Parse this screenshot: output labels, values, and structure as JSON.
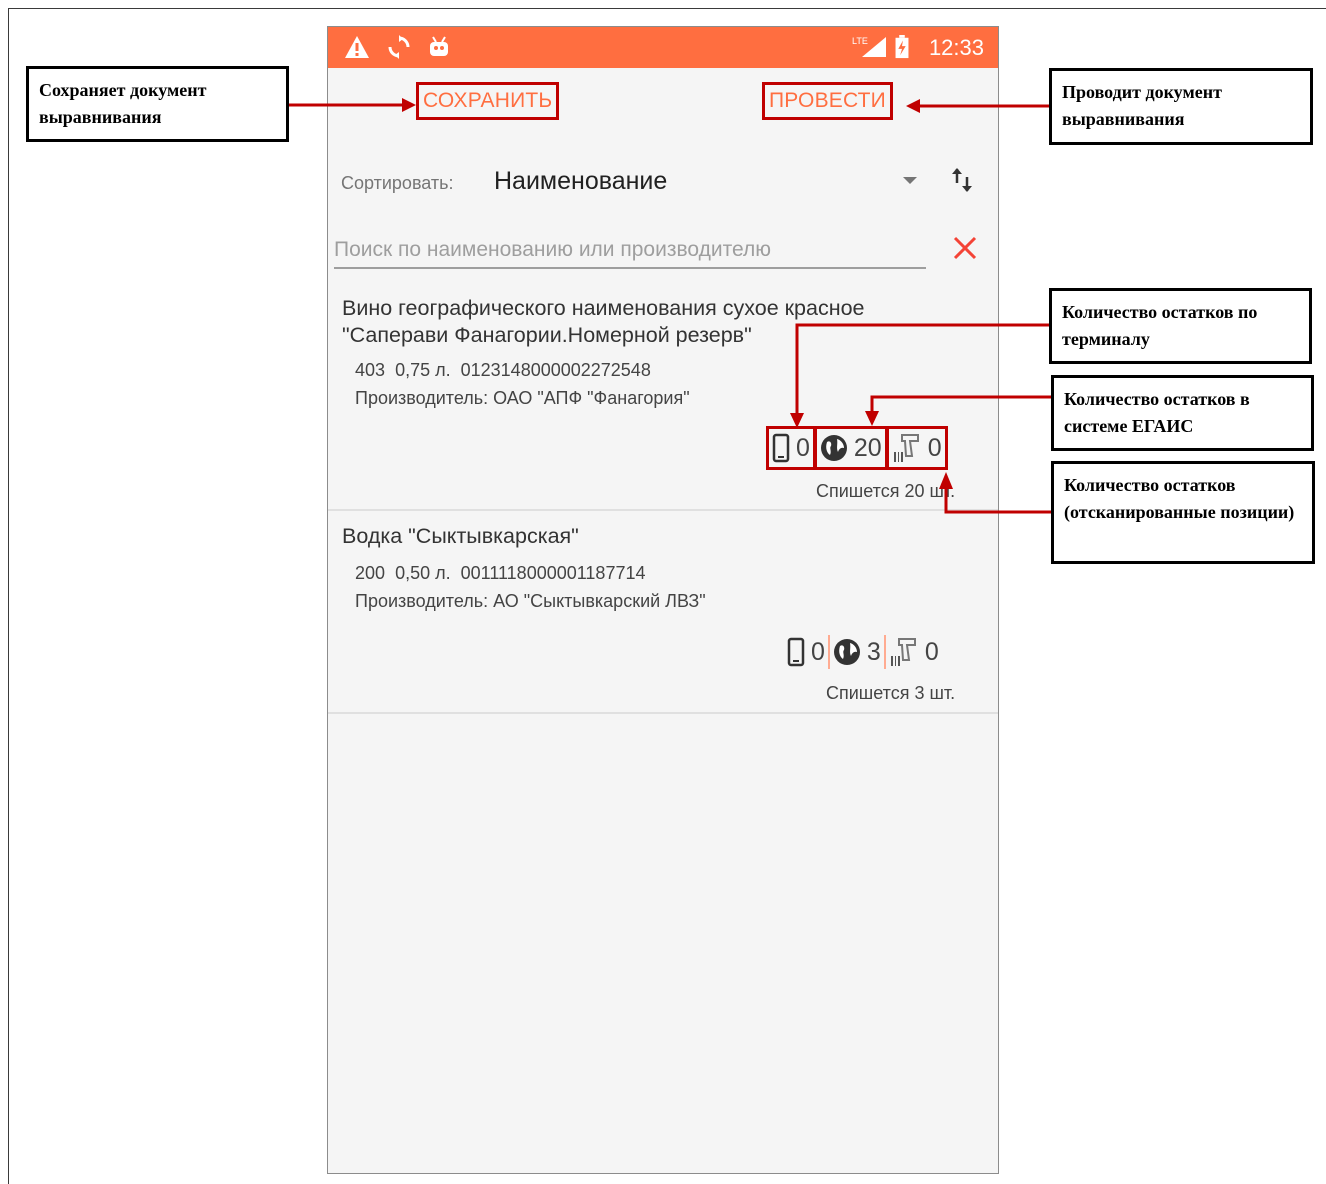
{
  "status_bar": {
    "time": "12:33",
    "network": "LTE"
  },
  "toolbar": {
    "save_label": "СОХРАНИТЬ",
    "post_label": "ПРОВЕСТИ"
  },
  "sort": {
    "label": "Сортировать:",
    "value": "Наименование"
  },
  "search": {
    "placeholder": "Поиск по наименованию или производителю"
  },
  "items": [
    {
      "name": "Вино географического наименования сухое красное \"Саперави Фанагории.Номерной резерв\"",
      "code": "403",
      "volume": "0,75 л.",
      "barcode": "0123148000002272548",
      "producer": "Производитель: ОАО \"АПФ \"Фанагория\"",
      "terminal_count": "0",
      "egais_count": "20",
      "scanned_count": "0",
      "writeoff": "Спишется 20 шт."
    },
    {
      "name": "Водка \"Сыктывкарская\"",
      "code": "200",
      "volume": "0,50 л.",
      "barcode": "0011118000001187714",
      "producer": "Производитель: АО \"Сыктывкарский ЛВЗ\"",
      "terminal_count": "0",
      "egais_count": "3",
      "scanned_count": "0",
      "writeoff": "Спишется 3 шт."
    }
  ],
  "annotations": {
    "save": "Сохраняет документ выравнивания",
    "post": "Проводит документ выравнивания",
    "terminal": "Количество остатков по терминалу",
    "egais": "Количество остатков в системе ЕГАИС",
    "scanned": "Количество остатков (отсканированные позиции)"
  },
  "colors": {
    "accent": "#ff6e40",
    "annotation_red": "#c00000"
  },
  "icons": [
    "warning-icon",
    "sync-icon",
    "android-icon",
    "signal-icon",
    "battery-icon",
    "sort-order-icon",
    "clear-icon",
    "phone-icon",
    "globe-icon",
    "scanner-icon"
  ]
}
